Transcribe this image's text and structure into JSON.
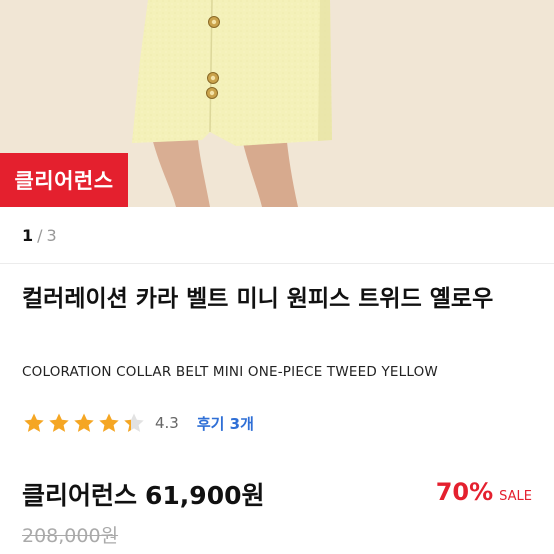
{
  "hero": {
    "image_desc": "product photo",
    "badge_label": "클리어런스"
  },
  "pager": {
    "current": "1",
    "separator": "/",
    "total": "3"
  },
  "product": {
    "title_ko": "컬러레이션 카라 벨트 미니 원피스 트위드 옐로우",
    "title_en": "COLORATION COLLAR BELT MINI ONE-PIECE TWEED YELLOW"
  },
  "rating": {
    "stars": 4.3,
    "score_text": "4.3",
    "reviews_label": "후기 3개",
    "star_color": "#f5a623"
  },
  "price": {
    "label": "클리어런스",
    "sale_price": "61,900원",
    "discount_rate": "70%",
    "sale_label": "SALE",
    "original_price": "208,000원",
    "accent_color": "#e4202e"
  }
}
